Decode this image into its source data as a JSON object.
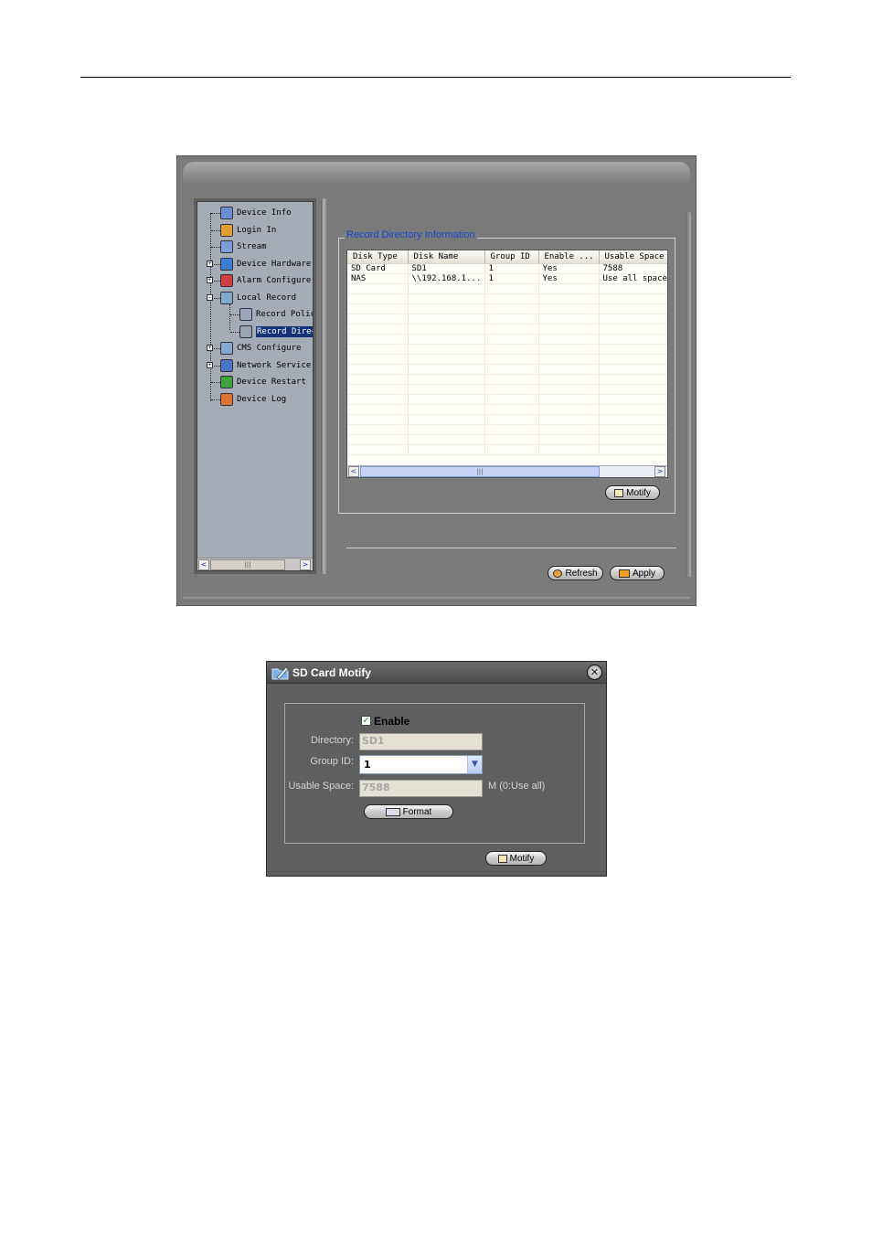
{
  "main_window": {
    "tree": {
      "items": [
        {
          "label": "Device Info",
          "icon": "device-info-icon",
          "color": "#6a8fd0"
        },
        {
          "label": "Login In",
          "icon": "login-icon",
          "color": "#e0a030"
        },
        {
          "label": "Stream",
          "icon": "stream-icon",
          "color": "#7b9cd8"
        },
        {
          "label": "Device Hardware",
          "icon": "hardware-icon",
          "color": "#3d7fd6"
        },
        {
          "label": "Alarm Configure",
          "icon": "alarm-icon",
          "color": "#d04040"
        },
        {
          "label": "Local Record",
          "icon": "local-record-icon",
          "color": "#7fa9c9"
        },
        {
          "label": "Record Polic",
          "icon": "record-policy-icon",
          "color": "#9aa7b8"
        },
        {
          "label": "Record Direc",
          "icon": "record-directory-icon",
          "color": "#9aa5b2"
        },
        {
          "label": "CMS Configure",
          "icon": "cms-icon",
          "color": "#86a8cf"
        },
        {
          "label": "Network Service",
          "icon": "network-icon",
          "color": "#4a78c4"
        },
        {
          "label": "Device Restart",
          "icon": "restart-icon",
          "color": "#41a33b"
        },
        {
          "label": "Device Log",
          "icon": "log-icon",
          "color": "#e07030"
        }
      ],
      "selected_index": 7
    },
    "record_directory": {
      "title": "Record Directory Information",
      "columns": [
        "Disk Type",
        "Disk Name",
        "Group ID",
        "Enable ...",
        "Usable Space"
      ],
      "rows": [
        [
          "SD Card",
          "SD1",
          "1",
          "Yes",
          "7588"
        ],
        [
          "NAS",
          "\\\\192.168.1...",
          "1",
          "Yes",
          "Use all space"
        ]
      ],
      "modify_label": "Motify"
    },
    "refresh_label": "Refresh",
    "apply_label": "Apply"
  },
  "dialog": {
    "title": "SD Card Motify",
    "enable_label": "Enable",
    "enable_checked": true,
    "directory_label": "Directory:",
    "directory_value": "SD1",
    "group_id_label": "Group ID:",
    "group_id_value": "1",
    "usable_space_label": "Usable Space:",
    "usable_space_value": "7588",
    "usable_space_unit": "M (0:Use all)",
    "format_label": "Format",
    "modify_label": "Motify"
  },
  "colors": {
    "window_gray": "#7b7b7b",
    "tree_bg": "#a6acb5",
    "selection": "#14327a",
    "group_title": "#1446c8"
  }
}
